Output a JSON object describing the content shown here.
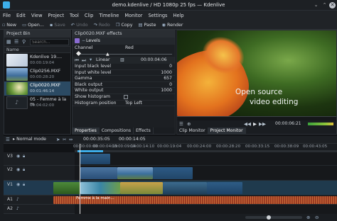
{
  "window": {
    "title": "demo.kdenlive / HD 1080p 25 fps — Kdenlive"
  },
  "menu": [
    "File",
    "Edit",
    "View",
    "Project",
    "Tool",
    "Clip",
    "Timeline",
    "Monitor",
    "Settings",
    "Help"
  ],
  "toolbar": {
    "new": "New",
    "open": "Open...",
    "save": "Save",
    "undo": "Undo",
    "redo": "Redo",
    "copy": "Copy",
    "paste": "Paste",
    "render": "Render"
  },
  "bin": {
    "title": "Project Bin",
    "search_placeholder": "Search...",
    "col_name": "Name",
    "clips": [
      {
        "name": "Kdenlive 19....",
        "dur": "00:00:19:04",
        "color": "#cfd8e4"
      },
      {
        "name": "Clip0256.MXF",
        "dur": "00:00:28:20",
        "color": "#5b86b8"
      },
      {
        "name": "Clip0020.MXF",
        "dur": "00:01:46:14",
        "color": "#6a9a3c"
      },
      {
        "name": "05 - Femme à la m",
        "dur": "00:04:02:00",
        "color": "#1e2328"
      }
    ]
  },
  "effects": {
    "title": "Clip0020.MXF effects",
    "effect_name": "Levels",
    "channel_label": "Channel",
    "channel_value": "Red",
    "interp": "Linear",
    "timecode": "00:00:04:06",
    "params": [
      {
        "label": "Input black level",
        "value": "0"
      },
      {
        "label": "Input white level",
        "value": "1000"
      },
      {
        "label": "Gamma",
        "value": "657"
      },
      {
        "label": "Black output",
        "value": "0"
      },
      {
        "label": "White output",
        "value": "1000"
      },
      {
        "label": "Show histogram",
        "value": ""
      },
      {
        "label": "Histogram position",
        "value": "Top Left"
      }
    ],
    "tabs": [
      "Properties",
      "Compositions",
      "Effects"
    ]
  },
  "monitor": {
    "overlay_line1": "Open source",
    "overlay_line2": "video editing",
    "timecode": "00:00:06:21",
    "tabs": [
      "Clip Monitor",
      "Project Monitor"
    ]
  },
  "timeline": {
    "mode": "Normal mode",
    "pos": "00:00:35:05",
    "dur": "00:00:14:05",
    "ruler": [
      "00:00:00:00",
      "00:00:04:19",
      "00:00:09:14",
      "00:00:14:10",
      "00:00:19:04",
      "00:00:24:00",
      "00:00:28:20",
      "00:00:33:15",
      "00:00:38:09",
      "00:00:43:05"
    ],
    "tracks": [
      "V3",
      "V2",
      "V1",
      "A1",
      "A2"
    ],
    "audio_clip_label": "Femme à la main..."
  },
  "colors": {
    "accent": "#3daee9",
    "video_clip": "#2f5d86",
    "audio_clip": "#1e5e5e",
    "playhead": "#e6e6e6"
  }
}
